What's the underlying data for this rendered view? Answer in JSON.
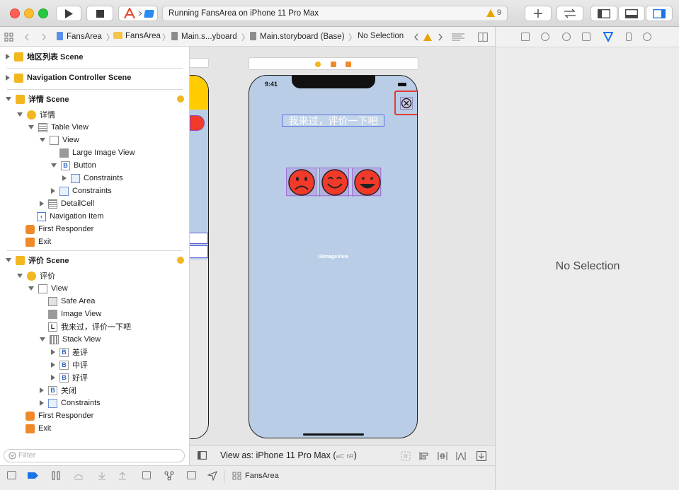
{
  "toolbar": {
    "status_text": "Running FansArea on iPhone 11 Pro Max",
    "warning_count": "9"
  },
  "jumpbar": {
    "crumbs": [
      "FansArea",
      "FansArea",
      "Main.s...yboard",
      "Main.storyboard (Base)",
      "No Selection"
    ]
  },
  "outline": {
    "scene1": "地区列表 Scene",
    "scene2": "Navigation Controller Scene",
    "scene3": "详情 Scene",
    "scene3_vc": "详情",
    "table_view": "Table View",
    "view": "View",
    "large_image_view": "Large Image View",
    "button": "Button",
    "constraints_inner": "Constraints",
    "constraints": "Constraints",
    "detail_cell": "DetailCell",
    "navigation_item": "Navigation Item",
    "first_responder": "First Responder",
    "exit": "Exit",
    "scene4": "评价 Scene",
    "scene4_vc": "评价",
    "view2": "View",
    "safe_area": "Safe Area",
    "image_view": "Image View",
    "label": "我来过，评价一下吧",
    "stack_view": "Stack View",
    "bad": "差评",
    "mid": "中评",
    "good": "好评",
    "close": "关闭",
    "constraints2": "Constraints",
    "first_responder2": "First Responder",
    "exit2": "Exit"
  },
  "canvas": {
    "time": "9:41",
    "label_text": "我来过，评价一下吧",
    "uiimageview_text": "UIImageView",
    "view_as": "View as: iPhone 11 Pro Max (",
    "size_w": "wC",
    "size_h": "hR",
    "view_as_end": ")"
  },
  "inspector": {
    "no_selection": "No Selection"
  },
  "footer": {
    "filter_placeholder": "Filter",
    "target_name": "FansArea"
  },
  "colors": {
    "accent": "#1a73e8",
    "emoji_face": "#f23a2a",
    "highlight_box": "#e53935",
    "phone_bg": "#b9cee6"
  }
}
